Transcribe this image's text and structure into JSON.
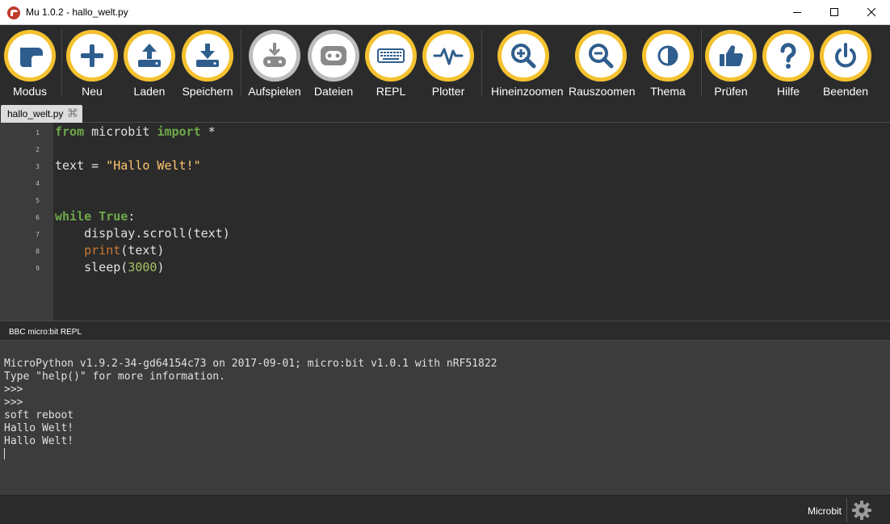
{
  "window": {
    "title": "Mu 1.0.2 - hallo_welt.py"
  },
  "toolbar": {
    "buttons": [
      {
        "label": "Modus",
        "icon": "mode-icon"
      },
      {
        "label": "Neu",
        "icon": "plus-icon"
      },
      {
        "label": "Laden",
        "icon": "upload-icon"
      },
      {
        "label": "Speichern",
        "icon": "download-icon"
      },
      {
        "label": "Aufspielen",
        "icon": "flash-icon"
      },
      {
        "label": "Dateien",
        "icon": "files-icon"
      },
      {
        "label": "REPL",
        "icon": "keyboard-icon"
      },
      {
        "label": "Plotter",
        "icon": "pulse-icon"
      },
      {
        "label": "Hineinzoomen",
        "icon": "zoom-in-icon"
      },
      {
        "label": "Rauszoomen",
        "icon": "zoom-out-icon"
      },
      {
        "label": "Thema",
        "icon": "contrast-icon"
      },
      {
        "label": "Prüfen",
        "icon": "thumbs-up-icon"
      },
      {
        "label": "Hilfe",
        "icon": "question-icon"
      },
      {
        "label": "Beenden",
        "icon": "power-icon"
      }
    ]
  },
  "tabs": [
    {
      "label": "hallo_welt.py",
      "close": "⌘"
    }
  ],
  "editor": {
    "line_numbers": [
      "1",
      "2",
      "3",
      "4",
      "5",
      "6",
      "7",
      "8",
      "9"
    ],
    "code": [
      "from microbit import *",
      "",
      "text = \"Hallo Welt!\"",
      "",
      "",
      "while True:",
      "    display.scroll(text)",
      "    print(text)",
      "    sleep(3000)"
    ]
  },
  "repl": {
    "title": "BBC micro:bit REPL",
    "lines": [
      "MicroPython v1.9.2-34-gd64154c73 on 2017-09-01; micro:bit v1.0.1 with nRF51822",
      "Type \"help()\" for more information.",
      ">>>",
      ">>>",
      "soft reboot",
      "Hallo Welt!",
      "Hallo Welt!"
    ]
  },
  "status": {
    "mode": "Microbit",
    "settings_icon": "gear-icon"
  },
  "colors": {
    "accent": "#f4c230",
    "button_face": "#ffffff",
    "icon": "#2f5e8e",
    "background": "#2b2b2b"
  }
}
